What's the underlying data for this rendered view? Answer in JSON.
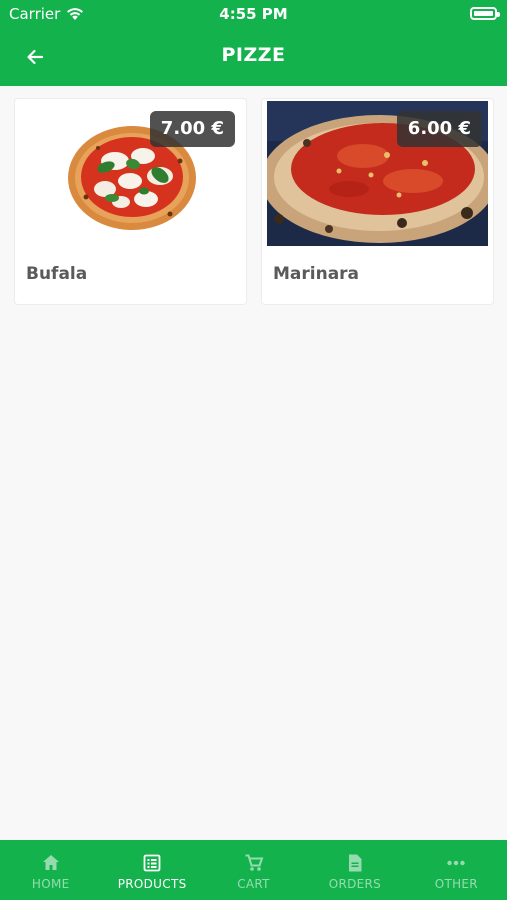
{
  "status_bar": {
    "carrier": "Carrier",
    "time": "4:55 PM"
  },
  "header": {
    "title": "PIZZE"
  },
  "products": [
    {
      "name": "Bufala",
      "price": "7.00 €"
    },
    {
      "name": "Marinara",
      "price": "6.00 €"
    }
  ],
  "tabs": [
    {
      "label": "HOME",
      "icon": "home-icon",
      "active": false
    },
    {
      "label": "PRODUCTS",
      "icon": "list-icon",
      "active": true
    },
    {
      "label": "CART",
      "icon": "cart-icon",
      "active": false
    },
    {
      "label": "ORDERS",
      "icon": "document-icon",
      "active": false
    },
    {
      "label": "OTHER",
      "icon": "more-icon",
      "active": false
    }
  ],
  "colors": {
    "primary": "#13b24d",
    "price_badge": "#323232"
  }
}
